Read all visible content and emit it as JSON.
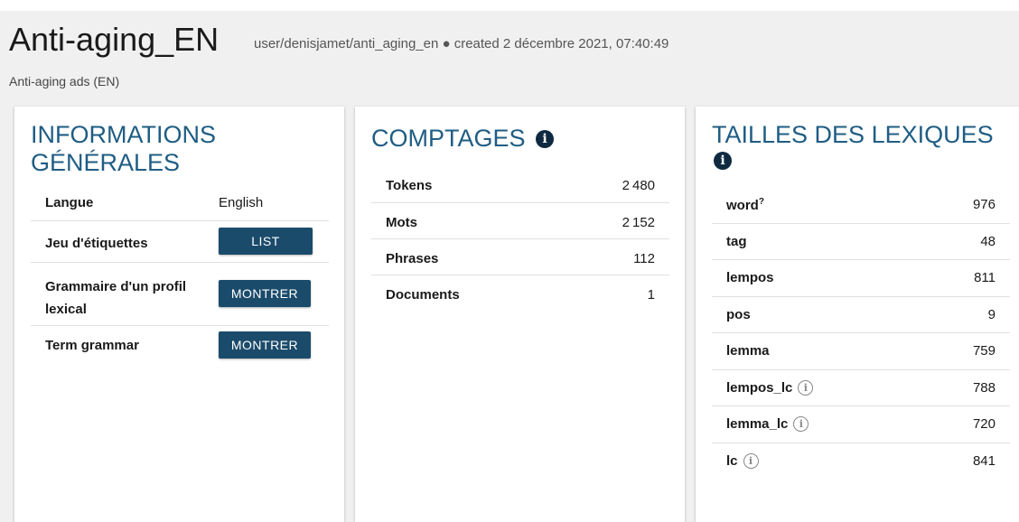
{
  "corpus": {
    "title": "Anti-aging_EN",
    "meta": "user/denisjamet/anti_aging_en ● created 2 décembre 2021, 07:40:49",
    "description": "Anti-aging ads (EN)"
  },
  "general": {
    "title": "INFORMATIONS GÉNÉRALES",
    "language_label": "Langue",
    "language_value": "English",
    "tagset_label": "Jeu d'étiquettes",
    "tagset_button": "LIST",
    "sketch_grammar_label": "Grammaire d'un profil lexical",
    "sketch_grammar_button": "MONTRER",
    "term_grammar_label": "Term grammar",
    "term_grammar_button": "MONTRER"
  },
  "counts": {
    "title": "COMPTAGES",
    "rows": [
      {
        "label": "Tokens",
        "value": "2 480"
      },
      {
        "label": "Mots",
        "value": "2 152"
      },
      {
        "label": "Phrases",
        "value": "112"
      },
      {
        "label": "Documents",
        "value": "1"
      }
    ]
  },
  "lexicon": {
    "title": "TAILLES DES LEXIQUES",
    "rows": [
      {
        "label": "word",
        "sup": "?",
        "value": "976"
      },
      {
        "label": "tag",
        "value": "48"
      },
      {
        "label": "lempos",
        "value": "811"
      },
      {
        "label": "pos",
        "value": "9"
      },
      {
        "label": "lemma",
        "value": "759"
      },
      {
        "label": "lempos_lc",
        "value": "788"
      },
      {
        "label": "lemma_lc",
        "value": "720"
      },
      {
        "label": "lc",
        "value": "841"
      }
    ]
  },
  "icons": {
    "info_filled": "i",
    "info_outline": "i"
  },
  "colors": {
    "accent": "#1f5d84",
    "button": "#1b4b6b"
  }
}
